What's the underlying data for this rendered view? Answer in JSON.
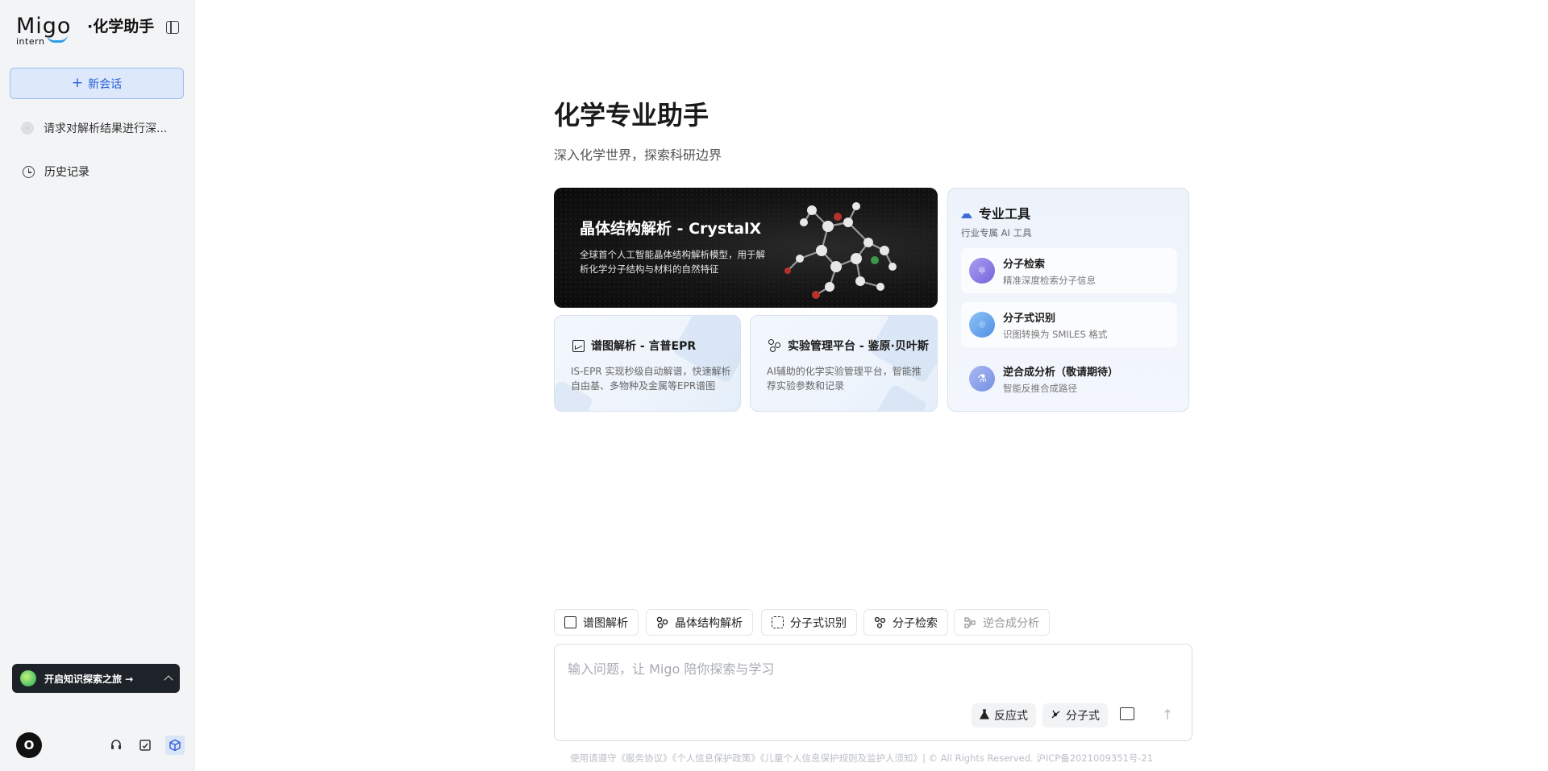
{
  "sidebar": {
    "logo_text": "Migo",
    "logo_sub": "intern",
    "app_title": "·化学助手",
    "new_chat_label": "新会话",
    "sessions": [
      {
        "label": "请求对解析结果进行深..."
      }
    ],
    "history_label": "历史记录",
    "explore_label": "开启知识探索之旅 →",
    "avatar_letter": "O"
  },
  "main": {
    "title": "化学专业助手",
    "subtitle": "深入化学世界，探索科研边界",
    "hero": {
      "title": "晶体结构解析 - CrystalX",
      "desc": "全球首个人工智能晶体结构解析模型，用于解析化学分子结构与材料的自然特征"
    },
    "cards": [
      {
        "title": "谱图解析 - 言普EPR",
        "desc": "IS-EPR 实现秒级自动解谱，快速解析自由基、多物种及金属等EPR谱图"
      },
      {
        "title": "实验管理平台 - 鉴原·贝叶斯",
        "desc": "AI辅助的化学实验管理平台，智能推荐实验参数和记录"
      }
    ],
    "tools": {
      "title": "专业工具",
      "subtitle": "行业专属 AI 工具",
      "items": [
        {
          "name": "分子检索",
          "desc": "精准深度检索分子信息",
          "color": "#8b7fe6"
        },
        {
          "name": "分子式识别",
          "desc": "识图转换为 SMILES 格式",
          "color": "#6ea7ee"
        },
        {
          "name": "逆合成分析（敬请期待）",
          "desc": "智能反推合成路径",
          "color": "#8fa4ea"
        }
      ]
    }
  },
  "chips": [
    {
      "label": "谱图解析",
      "disabled": false
    },
    {
      "label": "晶体结构解析",
      "disabled": false
    },
    {
      "label": "分子式识别",
      "disabled": false
    },
    {
      "label": "分子检索",
      "disabled": false
    },
    {
      "label": "逆合成分析",
      "disabled": true
    }
  ],
  "input": {
    "placeholder": "输入问题，让 Migo 陪你探索与学习",
    "reaction_label": "反应式",
    "molecule_label": "分子式"
  },
  "footer": "使用请遵守《服务协议》《个人信息保护政策》《儿童个人信息保护规则及监护人须知》| © All Rights Reserved. 沪ICP备2021009351号-21"
}
